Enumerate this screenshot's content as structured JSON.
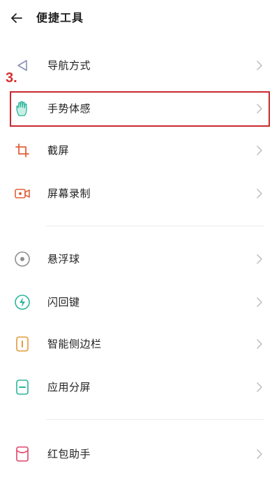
{
  "header": {
    "back_icon": "arrow-left-icon",
    "title": "便捷工具"
  },
  "annotation": {
    "step_label": "3.",
    "color": "#c8282d"
  },
  "items": [
    {
      "label": "导航方式",
      "icon": "navigation-triangle-icon",
      "icon_color": "#8a8fb5"
    },
    {
      "label": "手势体感",
      "icon": "hand-gesture-icon",
      "icon_color": "#2bb59a"
    },
    {
      "label": "截屏",
      "icon": "crop-screenshot-icon",
      "icon_color": "#e0613a"
    },
    {
      "label": "屏幕录制",
      "icon": "video-record-icon",
      "icon_color": "#e0613a"
    },
    {
      "label": "悬浮球",
      "icon": "floating-ball-icon",
      "icon_color": "#8e8e8e"
    },
    {
      "label": "闪回键",
      "icon": "flash-back-icon",
      "icon_color": "#2bb59a"
    },
    {
      "label": "智能侧边栏",
      "icon": "smart-sidebar-icon",
      "icon_color": "#e39a3a"
    },
    {
      "label": "应用分屏",
      "icon": "split-screen-icon",
      "icon_color": "#2bb59a"
    },
    {
      "label": "红包助手",
      "icon": "red-packet-icon",
      "icon_color": "#e0456a"
    }
  ],
  "chevron_color": "#c4c4c4"
}
